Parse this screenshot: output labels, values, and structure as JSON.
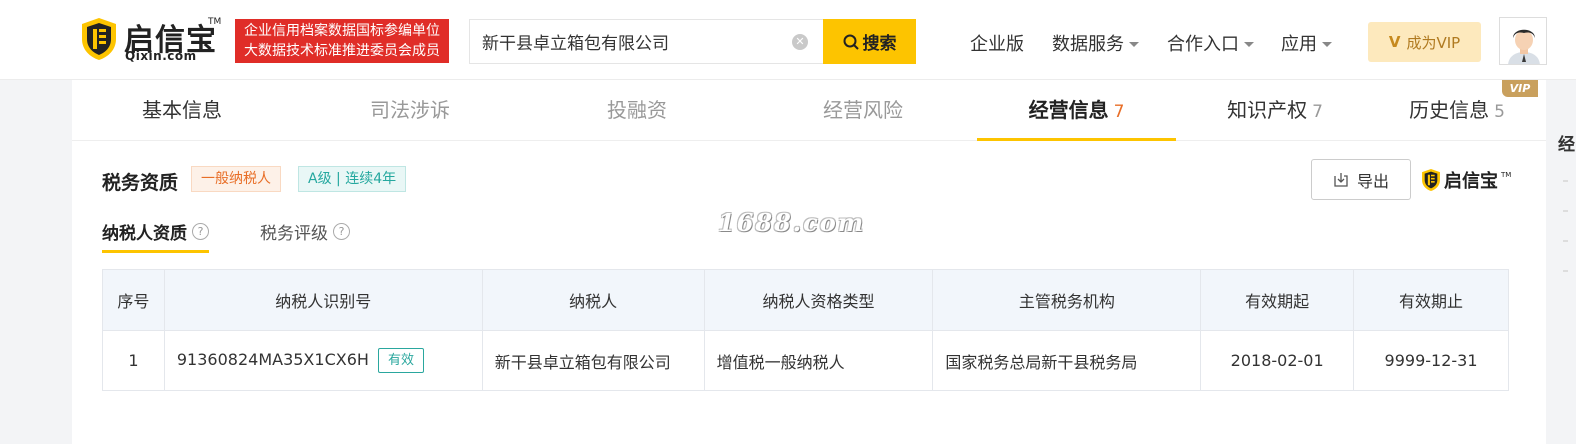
{
  "header": {
    "logo": {
      "name": "启信宝",
      "tm": "TM",
      "sub": "Qixin.com"
    },
    "banner": {
      "line1": "企业信用档案数据国标参编单位",
      "line2": "大数据技术标准推进委员会成员"
    },
    "search": {
      "value": "新干县卓立箱包有限公司",
      "button_label": "搜索"
    },
    "nav": [
      {
        "label": "企业版"
      },
      {
        "label": "数据服务"
      },
      {
        "label": "合作入口"
      },
      {
        "label": "应用"
      }
    ],
    "vip": {
      "icon": "V",
      "label": "成为VIP"
    }
  },
  "tabs": [
    {
      "label": "基本信息",
      "count": ""
    },
    {
      "label": "司法涉诉",
      "count": ""
    },
    {
      "label": "投融资",
      "count": ""
    },
    {
      "label": "经营风险",
      "count": ""
    },
    {
      "label": "经营信息",
      "count": "7"
    },
    {
      "label": "知识产权",
      "count": "7"
    },
    {
      "label": "历史信息",
      "count": "5"
    }
  ],
  "vip_tag": "VIP",
  "section": {
    "title": "税务资质",
    "badges": [
      "一般纳税人",
      "A级 | 连续4年"
    ],
    "export_label": "导出",
    "mini_logo": "启信宝",
    "subtabs": [
      "纳税人资质",
      "税务评级"
    ],
    "watermark": "1688.com"
  },
  "table": {
    "headers": [
      "序号",
      "纳税人识别号",
      "纳税人",
      "纳税人资格类型",
      "主管税务机构",
      "有效期起",
      "有效期止"
    ],
    "rows": [
      {
        "index": "1",
        "tax_id": "91360824MA35X1CX6H",
        "status": "有效",
        "taxpayer": "新干县卓立箱包有限公司",
        "qual_type": "增值税一般纳税人",
        "authority": "国家税务总局新干县税务局",
        "start": "2018-02-01",
        "end": "9999-12-31"
      }
    ]
  },
  "side_fragment": "经",
  "colors": {
    "accent_yellow": "#fdc400",
    "banner_red": "#e02d28",
    "orange": "#e86e27",
    "teal": "#25a89f"
  }
}
